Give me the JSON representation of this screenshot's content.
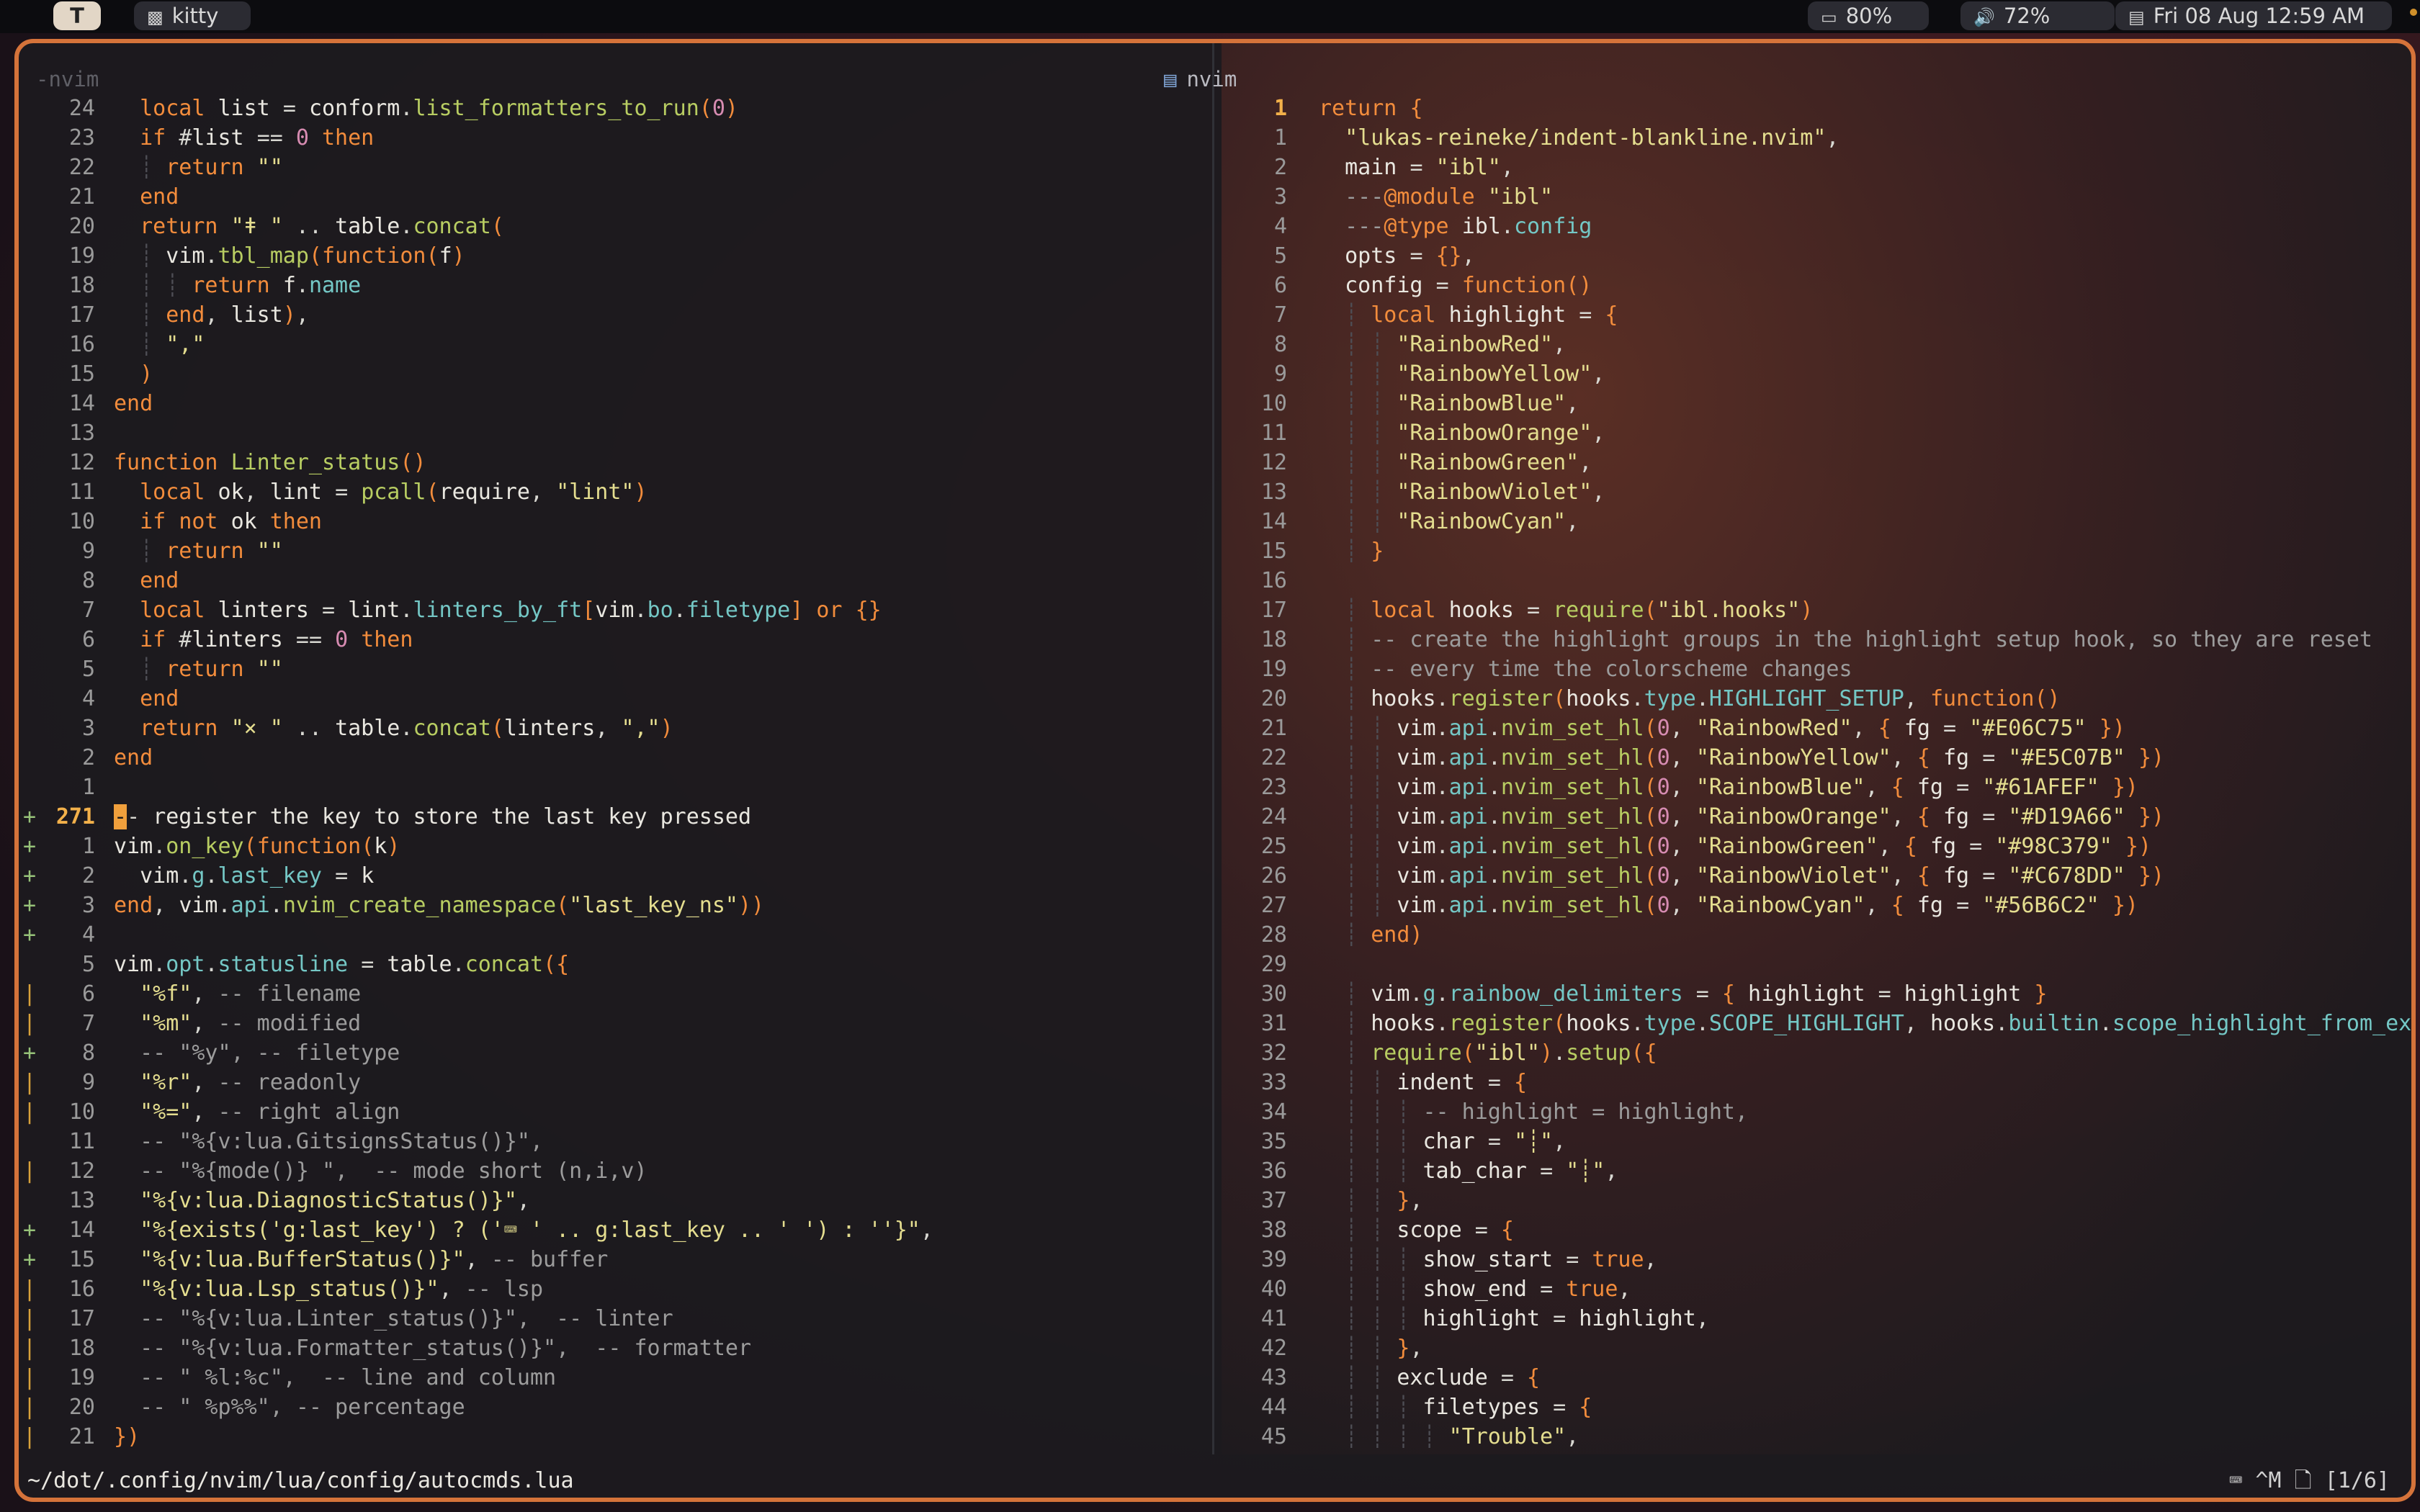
{
  "topbar": {
    "workspace": "T",
    "app_icon": "terminal-icon",
    "app_name": "kitty",
    "battery_icon": "battery-icon",
    "battery": "80%",
    "volume_icon": "speaker-icon",
    "volume": "72%",
    "calendar_icon": "calendar-icon",
    "datetime": "Fri 08 Aug 12:59 AM"
  },
  "colors": {
    "border_accent": "#d5733a",
    "keyword": "#f28c3c",
    "string": "#e4dd8f",
    "function": "#b8cd62",
    "comment": "#9c9c9c",
    "git_add": "#97c379",
    "git_change": "#d7a13a"
  },
  "left_pane": {
    "title": "-nvim",
    "lines": [
      {
        "n": "24",
        "s": "",
        "t": "  local list = conform.list_formatters_to_run(0)"
      },
      {
        "n": "23",
        "s": "",
        "t": "  if #list == 0 then"
      },
      {
        "n": "22",
        "s": "",
        "t": "    return \"\""
      },
      {
        "n": "21",
        "s": "",
        "t": "  end"
      },
      {
        "n": "20",
        "s": "",
        "t": "  return \"ǂ \" .. table.concat("
      },
      {
        "n": "19",
        "s": "",
        "t": "    vim.tbl_map(function(f)"
      },
      {
        "n": "18",
        "s": "",
        "t": "      return f.name"
      },
      {
        "n": "17",
        "s": "",
        "t": "    end, list),"
      },
      {
        "n": "16",
        "s": "",
        "t": "    \",\""
      },
      {
        "n": "15",
        "s": "",
        "t": "  )"
      },
      {
        "n": "14",
        "s": "",
        "t": "end"
      },
      {
        "n": "13",
        "s": "",
        "t": ""
      },
      {
        "n": "12",
        "s": "",
        "t": "function Linter_status()"
      },
      {
        "n": "11",
        "s": "",
        "t": "  local ok, lint = pcall(require, \"lint\")"
      },
      {
        "n": "10",
        "s": "",
        "t": "  if not ok then"
      },
      {
        "n": "9",
        "s": "",
        "t": "    return \"\""
      },
      {
        "n": "8",
        "s": "",
        "t": "  end"
      },
      {
        "n": "7",
        "s": "",
        "t": "  local linters = lint.linters_by_ft[vim.bo.filetype] or {}"
      },
      {
        "n": "6",
        "s": "",
        "t": "  if #linters == 0 then"
      },
      {
        "n": "5",
        "s": "",
        "t": "    return \"\""
      },
      {
        "n": "4",
        "s": "",
        "t": "  end"
      },
      {
        "n": "3",
        "s": "",
        "t": "  return \"⨯ \" .. table.concat(linters, \",\")"
      },
      {
        "n": "2",
        "s": "",
        "t": "end"
      },
      {
        "n": "1",
        "s": "",
        "t": ""
      },
      {
        "n": "271",
        "s": "+",
        "t": "-- register the key to store the last key pressed",
        "cur": true
      },
      {
        "n": "1",
        "s": "+",
        "t": "vim.on_key(function(k)"
      },
      {
        "n": "2",
        "s": "+",
        "t": "  vim.g.last_key = k"
      },
      {
        "n": "3",
        "s": "+",
        "t": "end, vim.api.nvim_create_namespace(\"last_key_ns\"))"
      },
      {
        "n": "4",
        "s": "+",
        "t": ""
      },
      {
        "n": "5",
        "s": "",
        "t": "vim.opt.statusline = table.concat({"
      },
      {
        "n": "6",
        "s": "|",
        "t": "  \"%f\", -- filename"
      },
      {
        "n": "7",
        "s": "|",
        "t": "  \"%m\", -- modified"
      },
      {
        "n": "8",
        "s": "+",
        "t": "  -- \"%y\", -- filetype"
      },
      {
        "n": "9",
        "s": "|",
        "t": "  \"%r\", -- readonly"
      },
      {
        "n": "10",
        "s": "|",
        "t": "  \"%=\", -- right align"
      },
      {
        "n": "11",
        "s": "",
        "t": "  -- \"%{v:lua.GitsignsStatus()}\","
      },
      {
        "n": "12",
        "s": "|",
        "t": "  -- \"%{mode()} \",  -- mode short (n,i,v)"
      },
      {
        "n": "13",
        "s": "",
        "t": "  \"%{v:lua.DiagnosticStatus()}\","
      },
      {
        "n": "14",
        "s": "+",
        "t": "  \"%{exists('g:last_key') ? ('⌨ ' .. g:last_key .. ' ') : ''}\","
      },
      {
        "n": "15",
        "s": "+",
        "t": "  \"%{v:lua.BufferStatus()}\", -- buffer"
      },
      {
        "n": "16",
        "s": "|",
        "t": "  \"%{v:lua.Lsp_status()}\", -- lsp"
      },
      {
        "n": "17",
        "s": "|",
        "t": "  -- \"%{v:lua.Linter_status()}\",  -- linter"
      },
      {
        "n": "18",
        "s": "|",
        "t": "  -- \"%{v:lua.Formatter_status()}\",  -- formatter"
      },
      {
        "n": "19",
        "s": "|",
        "t": "  -- \" %l:%c\",  -- line and column"
      },
      {
        "n": "20",
        "s": "|",
        "t": "  -- \" %p%%\", -- percentage"
      },
      {
        "n": "21",
        "s": "|",
        "t": "})"
      }
    ]
  },
  "right_pane": {
    "title_icon": "window-icon",
    "title": "nvim",
    "lines": [
      {
        "n": "1",
        "t": "return {",
        "cur": true
      },
      {
        "n": "1",
        "t": "  \"lukas-reineke/indent-blankline.nvim\","
      },
      {
        "n": "2",
        "t": "  main = \"ibl\","
      },
      {
        "n": "3",
        "t": "  ---@module \"ibl\""
      },
      {
        "n": "4",
        "t": "  ---@type ibl.config"
      },
      {
        "n": "5",
        "t": "  opts = {},"
      },
      {
        "n": "6",
        "t": "  config = function()"
      },
      {
        "n": "7",
        "t": "    local highlight = {"
      },
      {
        "n": "8",
        "t": "      \"RainbowRed\","
      },
      {
        "n": "9",
        "t": "      \"RainbowYellow\","
      },
      {
        "n": "10",
        "t": "      \"RainbowBlue\","
      },
      {
        "n": "11",
        "t": "      \"RainbowOrange\","
      },
      {
        "n": "12",
        "t": "      \"RainbowGreen\","
      },
      {
        "n": "13",
        "t": "      \"RainbowViolet\","
      },
      {
        "n": "14",
        "t": "      \"RainbowCyan\","
      },
      {
        "n": "15",
        "t": "    }"
      },
      {
        "n": "16",
        "t": ""
      },
      {
        "n": "17",
        "t": "    local hooks = require(\"ibl.hooks\")"
      },
      {
        "n": "18",
        "t": "    -- create the highlight groups in the highlight setup hook, so they are reset"
      },
      {
        "n": "19",
        "t": "    -- every time the colorscheme changes"
      },
      {
        "n": "20",
        "t": "    hooks.register(hooks.type.HIGHLIGHT_SETUP, function()"
      },
      {
        "n": "21",
        "t": "      vim.api.nvim_set_hl(0, \"RainbowRed\", { fg = \"#E06C75\" })"
      },
      {
        "n": "22",
        "t": "      vim.api.nvim_set_hl(0, \"RainbowYellow\", { fg = \"#E5C07B\" })"
      },
      {
        "n": "23",
        "t": "      vim.api.nvim_set_hl(0, \"RainbowBlue\", { fg = \"#61AFEF\" })"
      },
      {
        "n": "24",
        "t": "      vim.api.nvim_set_hl(0, \"RainbowOrange\", { fg = \"#D19A66\" })"
      },
      {
        "n": "25",
        "t": "      vim.api.nvim_set_hl(0, \"RainbowGreen\", { fg = \"#98C379\" })"
      },
      {
        "n": "26",
        "t": "      vim.api.nvim_set_hl(0, \"RainbowViolet\", { fg = \"#C678DD\" })"
      },
      {
        "n": "27",
        "t": "      vim.api.nvim_set_hl(0, \"RainbowCyan\", { fg = \"#56B6C2\" })"
      },
      {
        "n": "28",
        "t": "    end)"
      },
      {
        "n": "29",
        "t": ""
      },
      {
        "n": "30",
        "t": "    vim.g.rainbow_delimiters = { highlight = highlight }"
      },
      {
        "n": "31",
        "t": "    hooks.register(hooks.type.SCOPE_HIGHLIGHT, hooks.builtin.scope_highlight_from_extma"
      },
      {
        "n": "32",
        "t": "    require(\"ibl\").setup({"
      },
      {
        "n": "33",
        "t": "      indent = {"
      },
      {
        "n": "34",
        "t": "        -- highlight = highlight,"
      },
      {
        "n": "35",
        "t": "        char = \"┊\","
      },
      {
        "n": "36",
        "t": "        tab_char = \"┊\","
      },
      {
        "n": "37",
        "t": "      },"
      },
      {
        "n": "38",
        "t": "      scope = {"
      },
      {
        "n": "39",
        "t": "        show_start = true,"
      },
      {
        "n": "40",
        "t": "        show_end = true,"
      },
      {
        "n": "41",
        "t": "        highlight = highlight,"
      },
      {
        "n": "42",
        "t": "      },"
      },
      {
        "n": "43",
        "t": "      exclude = {"
      },
      {
        "n": "44",
        "t": "        filetypes = {"
      },
      {
        "n": "45",
        "t": "          \"Trouble\","
      }
    ]
  },
  "statusline": {
    "path": "~/dot/.config/nvim/lua/config/autocmds.lua",
    "keyboard_icon": "keyboard-icon",
    "last_key": "^M",
    "file_icon": "file-icon",
    "buffer_status": "[1/6]"
  }
}
